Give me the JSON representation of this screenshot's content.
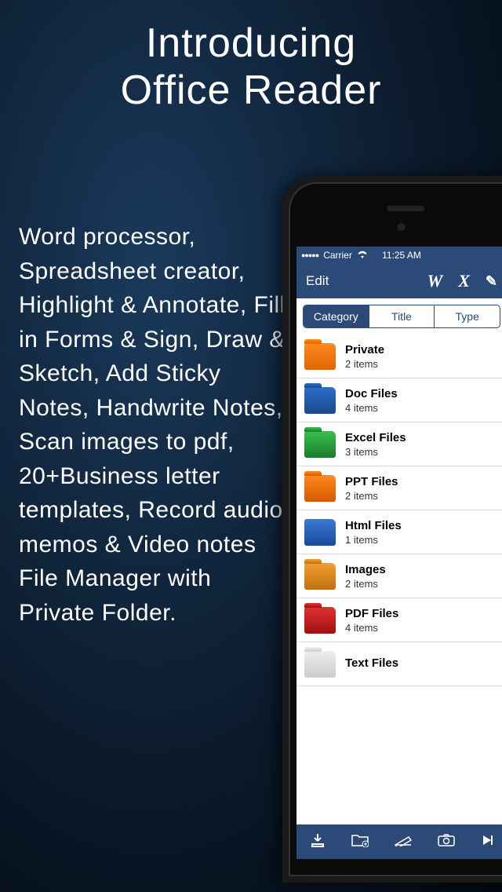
{
  "hero": {
    "line1": "Introducing",
    "line2": "Office Reader"
  },
  "features_text": "Word processor, Spreadsheet creator, Highlight & Annotate, Fill in Forms & Sign, Draw & Sketch, Add Sticky Notes, Handwrite Notes, Scan images to pdf, 20+Business letter templates, Record audio memos & Video notes File Manager with Private Folder.",
  "statusbar": {
    "dots": "●●●●●",
    "carrier": "Carrier",
    "wifi": "✶",
    "time": "11:25 AM"
  },
  "navbar": {
    "edit": "Edit",
    "w": "W",
    "x": "X",
    "pencil": "✎"
  },
  "segmented": {
    "category": "Category",
    "title": "Title",
    "type": "Type"
  },
  "folders": [
    {
      "title": "Private",
      "sub": "2 items",
      "icon": "ic-private"
    },
    {
      "title": "Doc Files",
      "sub": "4 items",
      "icon": "ic-doc"
    },
    {
      "title": "Excel Files",
      "sub": "3 items",
      "icon": "ic-excel"
    },
    {
      "title": "PPT Files",
      "sub": "2 items",
      "icon": "ic-ppt"
    },
    {
      "title": "Html Files",
      "sub": "1 items",
      "icon": "ic-html"
    },
    {
      "title": "Images",
      "sub": "2 items",
      "icon": "ic-images"
    },
    {
      "title": "PDF Files",
      "sub": "4 items",
      "icon": "ic-pdf"
    },
    {
      "title": "Text Files",
      "sub": "",
      "icon": "ic-text"
    }
  ],
  "toolbar": {
    "download": "⬇",
    "newfolder": "⊡",
    "scan": "⬚",
    "camera": "📷",
    "more": "▸"
  }
}
